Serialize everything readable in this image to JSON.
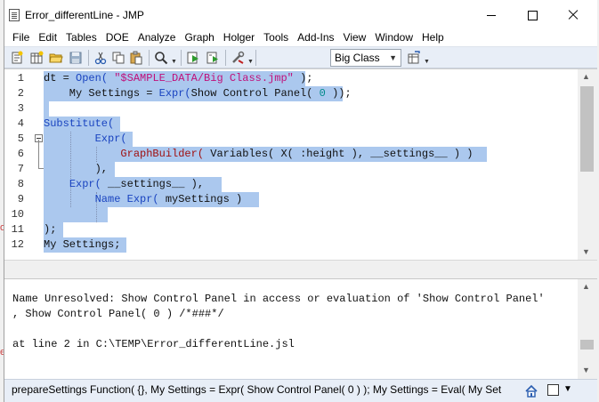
{
  "window": {
    "title": "Error_differentLine - JMP",
    "minimize": "",
    "maximize": "",
    "close": ""
  },
  "menu": [
    "File",
    "Edit",
    "Tables",
    "DOE",
    "Analyze",
    "Graph",
    "Holger",
    "Tools",
    "Add-Ins",
    "View",
    "Window",
    "Help"
  ],
  "toolbar": {
    "table_select": "Big Class",
    "icons": [
      "new-script-icon",
      "new-data-table-icon",
      "open-folder-icon",
      "save-icon",
      "cut-icon",
      "copy-icon",
      "paste-icon",
      "search-icon",
      "run-script-icon",
      "debug-icon",
      "tools-icon",
      "table-icon"
    ]
  },
  "editor": {
    "line_numbers": [
      "1",
      "2",
      "3",
      "4",
      "5",
      "6",
      "7",
      "8",
      "9",
      "10",
      "11",
      "12"
    ],
    "lines": [
      [
        {
          "t": "dt = "
        },
        {
          "t": "Open(",
          "c": "kw"
        },
        {
          "t": " "
        },
        {
          "t": "\"$SAMPLE_DATA/Big Class.jmp\"",
          "c": "str"
        },
        {
          "t": " );"
        }
      ],
      [
        {
          "t": "    My Settings = "
        },
        {
          "t": "Expr(",
          "c": "kw"
        },
        {
          "t": "Show Control Panel( "
        },
        {
          "t": "0",
          "c": "num"
        },
        {
          "t": " ));"
        }
      ],
      [
        {
          "t": ""
        }
      ],
      [
        {
          "t": "Substitute(",
          "c": "kw"
        }
      ],
      [
        {
          "t": "        "
        },
        {
          "t": "Expr(",
          "c": "kw"
        }
      ],
      [
        {
          "t": "            "
        },
        {
          "t": "GraphBuilder(",
          "c": "fn"
        },
        {
          "t": " Variables( X( :height ), __settings__ ) )"
        }
      ],
      [
        {
          "t": "        ),"
        }
      ],
      [
        {
          "t": "    "
        },
        {
          "t": "Expr(",
          "c": "kw"
        },
        {
          "t": " __settings__ ),"
        }
      ],
      [
        {
          "t": "        "
        },
        {
          "t": "Name Expr(",
          "c": "kw"
        },
        {
          "t": " mySettings )"
        }
      ],
      [
        {
          "t": ""
        }
      ],
      [
        {
          "t": ");"
        }
      ],
      [
        {
          "t": "My Settings;"
        }
      ]
    ]
  },
  "log": {
    "lines": [
      "Name Unresolved: Show Control Panel in access or evaluation of 'Show Control Panel'",
      ", Show Control Panel( 0 ) /*###*/",
      "",
      "at line 2 in C:\\TEMP\\Error_differentLine.jsl"
    ]
  },
  "status": {
    "text": "prepareSettings  Function( {},  My Settings = Expr(   Show Control Panel( 0 )  );  My Settings = Eval( My Set"
  },
  "colors": {
    "selection": "#abc8ee",
    "keyword": "#1a44c0",
    "function": "#a01010",
    "string": "#c0107a",
    "number": "#008a8a",
    "toolbar_bg": "#e8eef7"
  }
}
